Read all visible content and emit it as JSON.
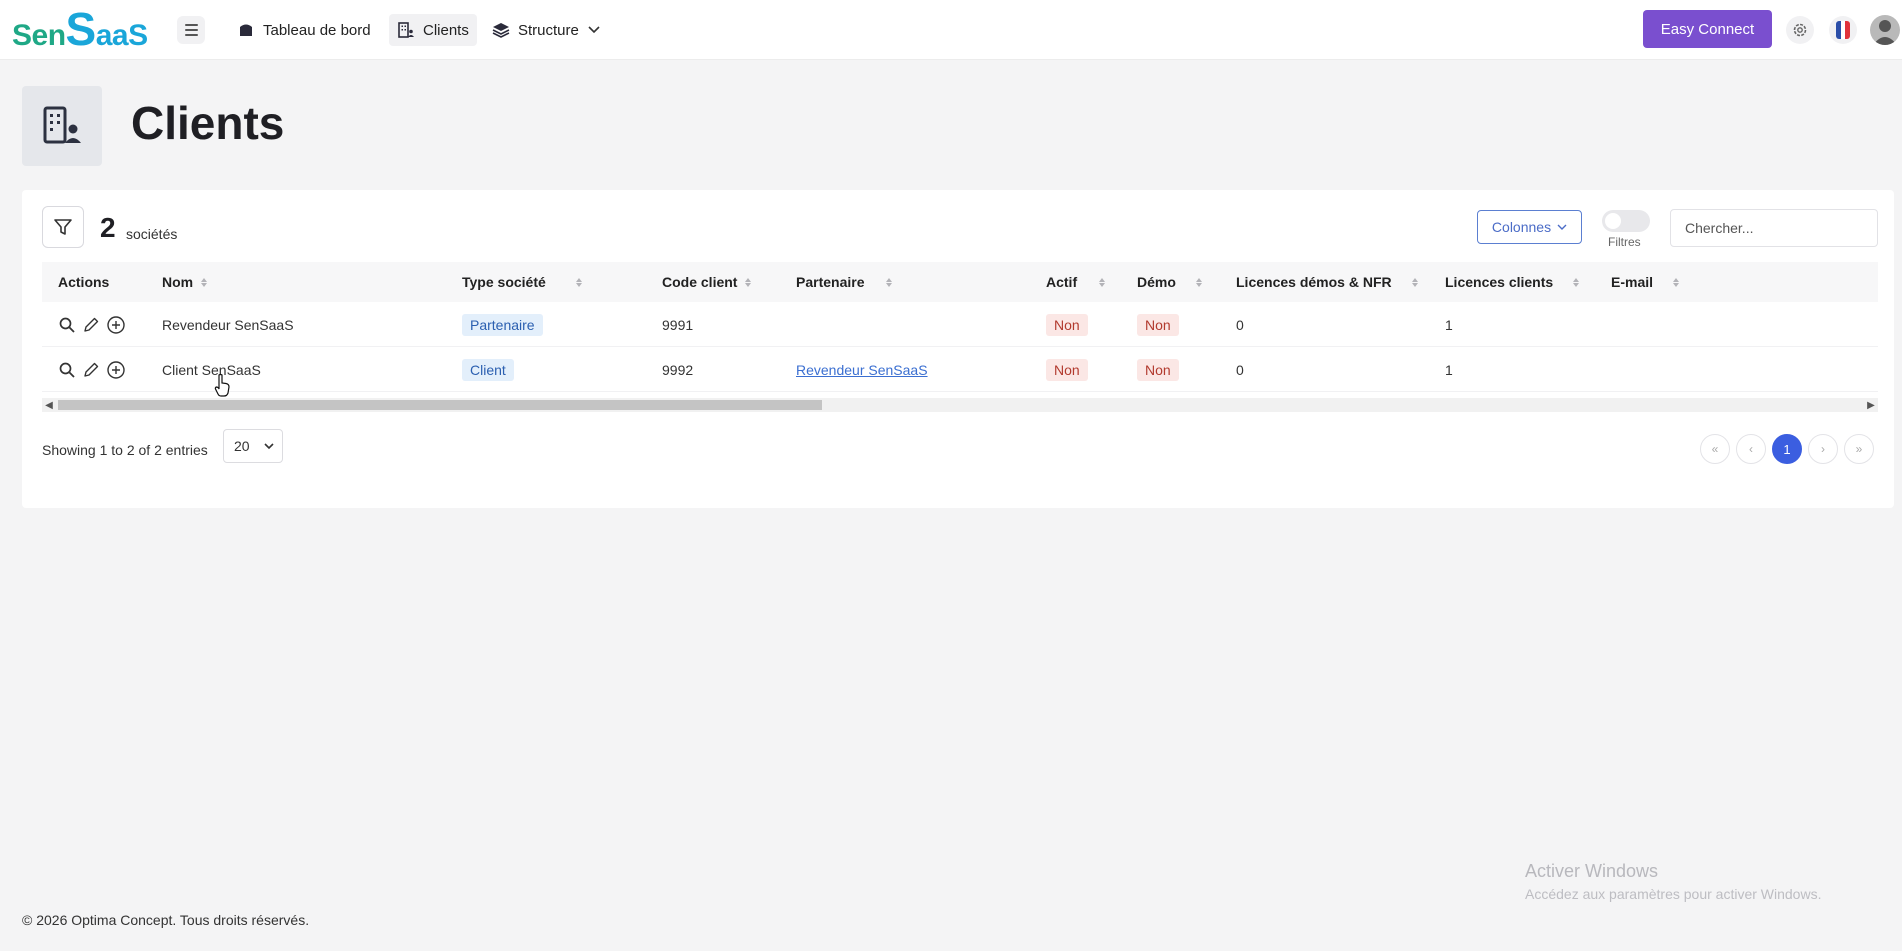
{
  "brand": {
    "logo_part1": "Sen",
    "logo_part2": "S",
    "logo_part3": "aaS"
  },
  "nav": {
    "items": [
      {
        "label": "Tableau de bord",
        "icon": "dashboard-icon"
      },
      {
        "label": "Clients",
        "icon": "building-icon"
      },
      {
        "label": "Structure",
        "icon": "layers-icon"
      }
    ],
    "easy_connect": "Easy Connect"
  },
  "page": {
    "title": "Clients"
  },
  "toolbar": {
    "count": "2",
    "count_label": "sociétés",
    "columns_label": "Colonnes",
    "filters_label": "Filtres",
    "search_placeholder": "Chercher..."
  },
  "table": {
    "headers": [
      "Actions",
      "Nom",
      "Type société",
      "Code client",
      "Partenaire",
      "Actif",
      "Démo",
      "Licences démos & NFR",
      "Licences clients",
      "E-mail"
    ],
    "rows": [
      {
        "nom": "Revendeur SenSaaS",
        "type": "Partenaire",
        "code": "9991",
        "partenaire": "",
        "actif": "Non",
        "demo": "Non",
        "lic_demo": "0",
        "lic_clients": "1",
        "email": ""
      },
      {
        "nom": "Client SenSaaS",
        "type": "Client",
        "code": "9992",
        "partenaire": "Revendeur SenSaaS",
        "actif": "Non",
        "demo": "Non",
        "lic_demo": "0",
        "lic_clients": "1",
        "email": ""
      }
    ]
  },
  "pagination": {
    "showing": "Showing 1 to 2 of 2 entries",
    "page_size": "20",
    "current_page": "1"
  },
  "footer": {
    "text": "© 2026 Optima Concept. Tous droits réservés."
  },
  "watermark": {
    "line1": "Activer Windows",
    "line2": "Accédez aux paramètres pour activer Windows."
  },
  "colors": {
    "accent": "#7a4fcf",
    "page_active": "#3b5ee0",
    "link": "#3b6fd1",
    "logo_green": "#1fa886",
    "logo_blue": "#1aa6d9"
  }
}
